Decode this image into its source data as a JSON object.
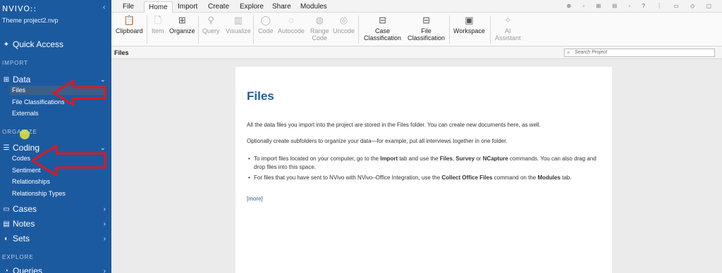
{
  "app": {
    "logo": "NVIVO",
    "logo_mark": "::",
    "project": "Theme project2.nvp"
  },
  "sidebar": {
    "quick_access": "Quick Access",
    "section_import": "IMPORT",
    "data": {
      "label": "Data",
      "items": [
        "Files",
        "File Classifications",
        "Externals"
      ]
    },
    "section_organize": "ORGANIZE",
    "coding": {
      "label": "Coding",
      "items": [
        "Codes",
        "Sentiment",
        "Relationships",
        "Relationship Types"
      ]
    },
    "cases": "Cases",
    "notes": "Notes",
    "sets": "Sets",
    "section_explore": "EXPLORE",
    "queries": "Queries"
  },
  "tabs": [
    "File",
    "Home",
    "Import",
    "Create",
    "Explore",
    "Share",
    "Modules"
  ],
  "active_tab": "Home",
  "ribbon": {
    "clipboard": "Clipboard",
    "item": "Item",
    "organize": "Organize",
    "query": "Query",
    "visualize": "Visualize",
    "code": "Code",
    "autocode": "Autocode",
    "range_code_1": "Range",
    "range_code_2": "Code",
    "uncode": "Uncode",
    "case_class_1": "Case",
    "case_class_2": "Classification",
    "file_class_1": "File",
    "file_class_2": "Classification",
    "workspace": "Workspace",
    "ai_1": "AI",
    "ai_2": "Assistant"
  },
  "header": {
    "title": "Files",
    "search_placeholder": "Search Project"
  },
  "panel": {
    "title": "Files",
    "para1": "All the data files you import into the project are stored in the Files folder. You can create new documents here, as well.",
    "para2": "Optionally create subfolders to organize your data—for example, put all interviews together in one folder.",
    "b1": {
      "t1": "To import files located on your computer, go to the ",
      "k1": "Import",
      "t2": " tab and use the ",
      "k2": "Files",
      "t3": ", ",
      "k3": "Survey",
      "t4": " or ",
      "k4": "NCapture",
      "t5": " commands. You can also drag and drop files into this space."
    },
    "b2": {
      "t1": "For files that you have sent to NVivo with NVivo–Office Integration, use the ",
      "k1": "Collect Office Files",
      "t2": " command on the ",
      "k2": "Modules",
      "t3": " tab."
    },
    "more": "[more]"
  },
  "colors": {
    "sidebar_bg": "#1c5aa0",
    "accent": "#1f5d9a",
    "arrow": "#e8141a"
  }
}
